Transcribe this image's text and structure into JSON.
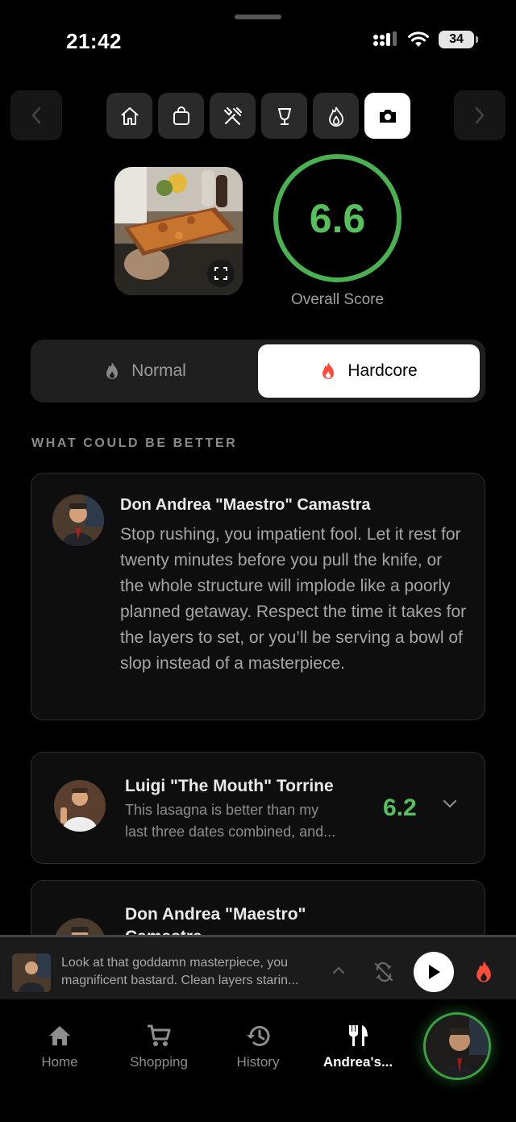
{
  "status": {
    "time": "21:42",
    "battery": "34"
  },
  "nav": {
    "categories": [
      "home-icon",
      "bag-icon",
      "tools-icon",
      "cocktail-icon",
      "flame-icon",
      "camera-icon"
    ],
    "active_category": "camera-icon"
  },
  "hero": {
    "score": "6.6",
    "score_label": "Overall Score"
  },
  "mode_toggle": {
    "normal": "Normal",
    "hardcore": "Hardcore",
    "selected": "Hardcore"
  },
  "section_title": "WHAT COULD BE BETTER",
  "reviews": [
    {
      "name": "Don Andrea \"Maestro\" Camastra",
      "text": "Stop rushing, you impatient fool. Let it rest for twenty minutes before you pull the knife, or the whole structure will implode like a poorly planned getaway. Respect the time it takes for the layers to set, or you’ll be serving a bowl of slop instead of a masterpiece."
    },
    {
      "name": "Luigi \"The Mouth\" Torrine",
      "snippet_line1": "This lasagna is better than my",
      "snippet_line2": "last three dates combined, and...",
      "score": "6.2"
    },
    {
      "name": "Don Andrea \"Maestro\" Camastra"
    }
  ],
  "player": {
    "line1": "Look at that goddamn masterpiece, you",
    "line2": "magnificent bastard. Clean layers starin..."
  },
  "tabs": [
    {
      "label": "Home"
    },
    {
      "label": "Shopping"
    },
    {
      "label": "History"
    },
    {
      "label": "Andrea's..."
    }
  ],
  "colors": {
    "accent_green": "#56c15a",
    "flame_red": "#ff4b3a",
    "background": "#000000"
  }
}
